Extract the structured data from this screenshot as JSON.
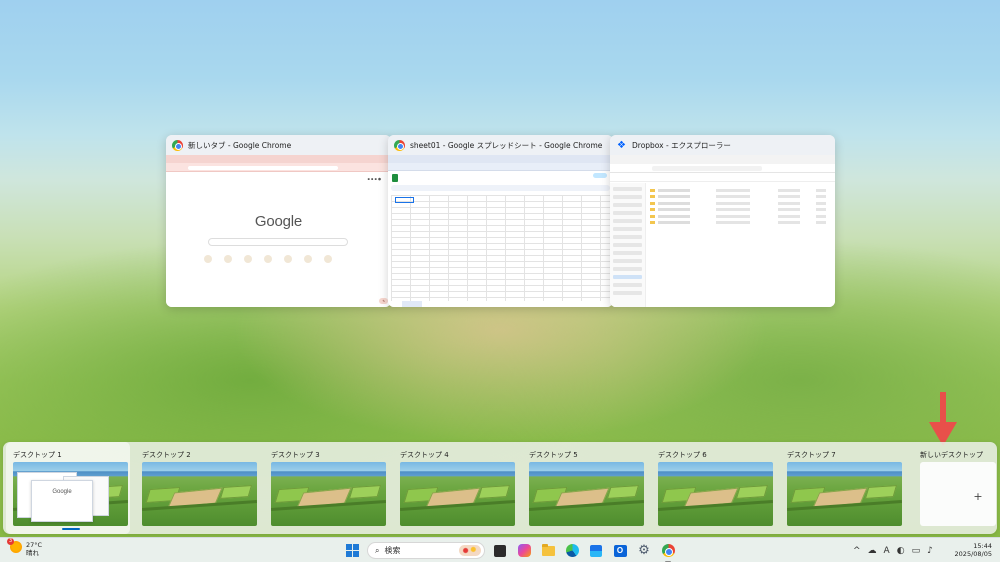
{
  "windows": [
    {
      "title": "新しいタブ - Google Chrome",
      "app_icon": "chrome-icon",
      "content_logo": "Google"
    },
    {
      "title": "sheet01 - Google スプレッドシート - Google Chrome",
      "app_icon": "chrome-icon"
    },
    {
      "title": "Dropbox - エクスプローラー",
      "app_icon": "dropbox-icon"
    }
  ],
  "desktops": [
    {
      "label": "デスクトップ 1",
      "active": true
    },
    {
      "label": "デスクトップ 2"
    },
    {
      "label": "デスクトップ 3"
    },
    {
      "label": "デスクトップ 4"
    },
    {
      "label": "デスクトップ 5"
    },
    {
      "label": "デスクトップ 6"
    },
    {
      "label": "デスクトップ 7"
    }
  ],
  "new_desktop": {
    "label": "新しいデスクトップ",
    "plus": "+"
  },
  "taskbar": {
    "weather": {
      "badge": "3",
      "temp": "27°C",
      "condition": "晴れ"
    },
    "search": {
      "placeholder": "検索",
      "icon": "search-icon"
    },
    "pinned_icons": [
      "windows-start-icon",
      "search-icon",
      "task-view-icon",
      "copilot-icon",
      "file-explorer-icon",
      "edge-icon",
      "store-icon",
      "outlook-icon",
      "settings-icon",
      "chrome-icon"
    ],
    "tray": {
      "chevron": "^",
      "ime": "A"
    },
    "clock": {
      "time": "15:44",
      "date": "2025/08/05"
    }
  },
  "colors": {
    "accent": "#0067c0",
    "annotation_arrow": "#e8504a"
  }
}
